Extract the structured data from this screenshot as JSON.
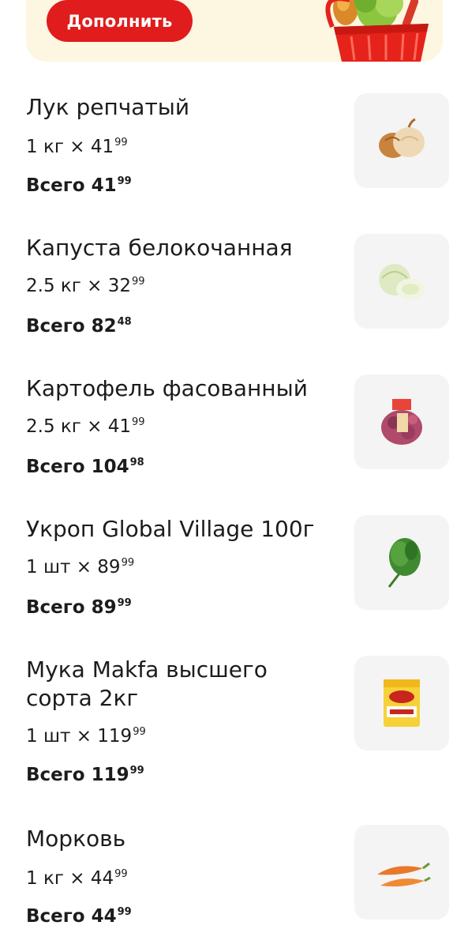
{
  "promo": {
    "button_label": "Дополнить"
  },
  "items": [
    {
      "name": "Лук репчатый",
      "qty_text": "1 кг × 41",
      "qty_kop": "99",
      "total_label": "Всего 41",
      "total_kop": "99",
      "image_icon": "onion-icon"
    },
    {
      "name": "Капуста белокочанная",
      "qty_text": "2.5 кг × 32",
      "qty_kop": "99",
      "total_label": "Всего 82",
      "total_kop": "48",
      "image_icon": "cabbage-icon"
    },
    {
      "name": "Картофель фасованный",
      "qty_text": "2.5 кг × 41",
      "qty_kop": "99",
      "total_label": "Всего 104",
      "total_kop": "98",
      "image_icon": "potato-bag-icon"
    },
    {
      "name": "Укроп Global Village 100г",
      "qty_text": "1 шт × 89",
      "qty_kop": "99",
      "total_label": "Всего 89",
      "total_kop": "99",
      "image_icon": "dill-icon"
    },
    {
      "name": "Мука Makfa высшего сорта 2кг",
      "qty_text": "1 шт × 119",
      "qty_kop": "99",
      "total_label": "Всего 119",
      "total_kop": "99",
      "image_icon": "flour-pack-icon"
    },
    {
      "name": "Морковь",
      "qty_text": "1 кг × 44",
      "qty_kop": "99",
      "total_label": "Всего 44",
      "total_kop": "99",
      "image_icon": "carrot-icon"
    }
  ],
  "colors": {
    "accent": "#e01c1c",
    "promo_bg": "#fdf6e0",
    "thumb_bg": "#f4f4f4"
  }
}
